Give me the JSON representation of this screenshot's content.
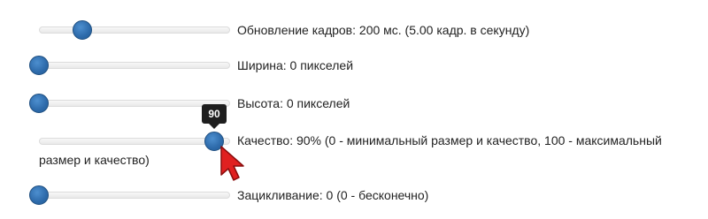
{
  "sliders": [
    {
      "name": "frame-update",
      "label": "Обновление кадров: 200 мс. (5.00 кадр. в секунду)",
      "position": 0.22
    },
    {
      "name": "width",
      "label": "Ширина: 0 пикселей",
      "position": 0.0
    },
    {
      "name": "height",
      "label": "Высота: 0 пикселей",
      "position": 0.0
    },
    {
      "name": "quality",
      "label_line1": "Качество: 90% (0 - минимальный размер и качество, 100 - максимальный",
      "label_line2": "размер и качество)",
      "value": 90,
      "position": 0.9,
      "tooltip": "90"
    },
    {
      "name": "loop",
      "label": "Зацикливание: 0 (0 - бесконечно)",
      "position": 0.0
    }
  ],
  "colors": {
    "thumb": "#2d6aaa",
    "tooltip_bg": "#1e1e1e",
    "cursor": "#e02020"
  },
  "icons": {
    "cursor": "mouse-pointer-icon"
  }
}
